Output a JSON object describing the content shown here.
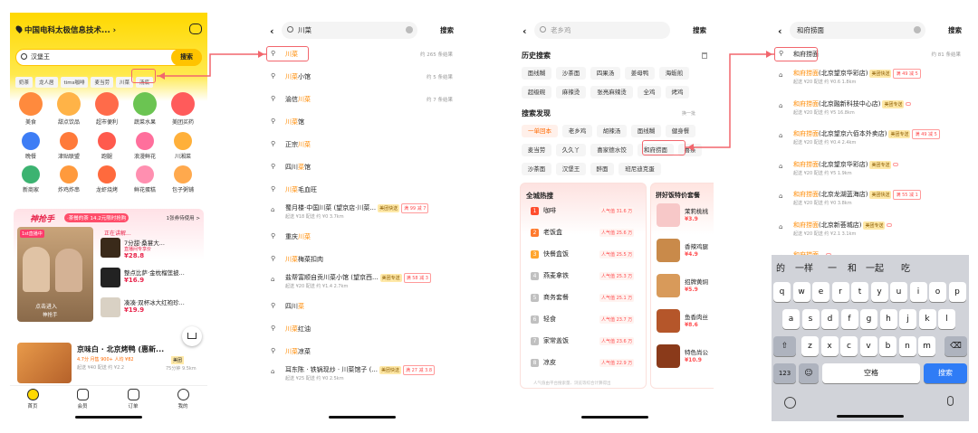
{
  "p1": {
    "location": "中国电科太极信息技术...",
    "search_value": "汉堡王",
    "search_btn": "搜索",
    "hot_tags": [
      "奶茶",
      "龙人居",
      "tims咖啡",
      "麦当劳",
      "川菜",
      "汤底"
    ],
    "categories": [
      {
        "label": "美食",
        "color": "#ff8a3d"
      },
      {
        "label": "甜点饮品",
        "color": "#ffb347"
      },
      {
        "label": "超市便利",
        "color": "#ff6b4a"
      },
      {
        "label": "蔬菜水果",
        "color": "#6bc452"
      },
      {
        "label": "美团买药",
        "color": "#ff5b5b"
      },
      {
        "label": "晚餐",
        "color": "#3d7df5"
      },
      {
        "label": "津贴联盟",
        "color": "#ff7a3a"
      },
      {
        "label": "跑腿",
        "color": "#ff5a4d"
      },
      {
        "label": "浪漫鲜花",
        "color": "#ff6f9c"
      },
      {
        "label": "川湘菜",
        "color": "#ffb03a"
      },
      {
        "label": "新商家",
        "color": "#3cb371"
      },
      {
        "label": "炸鸡炸串",
        "color": "#ff9a3d"
      },
      {
        "label": "龙虾烧烤",
        "color": "#ff6a3d"
      },
      {
        "label": "鲜花蛋糕",
        "color": "#ff8fb0"
      },
      {
        "label": "包子粥铺",
        "color": "#ffa94d"
      }
    ],
    "grab_title": "神抢手",
    "grab_tag": "·茶餐的茶 14.2元限时抢购",
    "grab_more": "1张券待使用 >",
    "live": "正在讲解...",
    "live_items": [
      {
        "name": "7分甜·桑葚大...",
        "tag": "直播间专享价",
        "price": "¥28.8"
      },
      {
        "name": "整点比萨·金枕榴莲披...",
        "tag": "",
        "price": "¥16.9"
      },
      {
        "name": "凑凑·双杯冰大红袍珍...",
        "tag": "",
        "price": "¥19.9"
      }
    ],
    "live_label": "1st直播中",
    "live_btn": "神抢手",
    "live_sub": "点击进入",
    "shop_name": "京味白 · 北京烤鸭 (惠新...",
    "shop_meta": "4.7分  月售 900+  人均 ¥82",
    "shop_sub": "起送 ¥40  配送 约 ¥2.2",
    "shop_badge": "美团",
    "shop_dist": "75分钟 9.5km",
    "tabs": [
      "首页",
      "会员",
      "订单",
      "我的"
    ]
  },
  "p2": {
    "query": "川菜",
    "search_btn": "搜索",
    "suggestions": [
      {
        "pre": "",
        "hl": "川菜",
        "post": "",
        "count": "约 265 条结果"
      },
      {
        "pre": "",
        "hl": "川菜",
        "post": "小馆",
        "count": "约 5 条结果"
      },
      {
        "pre": "渝信",
        "hl": "川菜",
        "post": "",
        "count": "约 7 条结果"
      },
      {
        "pre": "",
        "hl": "川菜",
        "post": "馆",
        "count": ""
      },
      {
        "pre": "正宗",
        "hl": "川菜",
        "post": "",
        "count": ""
      },
      {
        "pre": "四川",
        "hl": "菜",
        "post": "馆",
        "count": ""
      },
      {
        "pre": "",
        "hl": "川菜",
        "post": "毛血旺",
        "count": ""
      }
    ],
    "shop1": {
      "name": "蜀月楼·中国川菜 (望京店·川菜...",
      "sub": "起送 ¥18  配送 约 ¥0  3.7km",
      "b1": "美团快送",
      "b2": "满 99 减 7"
    },
    "more": [
      {
        "pre": "重庆",
        "hl": "川菜",
        "post": ""
      },
      {
        "pre": "",
        "hl": "川菜",
        "post": "梅菜扣肉"
      }
    ],
    "shop2": {
      "name": "盐帮富顺自贡川菜小馆 (望京西...",
      "sub": "起送 ¥20  配送 约 ¥1.4  2.7km",
      "b1": "美团专送",
      "b2": "满 58 减 3"
    },
    "more2": [
      {
        "pre": "四川",
        "hl": "菜",
        "post": ""
      },
      {
        "pre": "",
        "hl": "川菜",
        "post": "红油"
      },
      {
        "pre": "",
        "hl": "川菜",
        "post": "凉菜"
      }
    ],
    "shop3": {
      "name": "耳东陈 · 铁锅现炒 · 川菜馆子 (...",
      "sub": "起送 ¥25  配送 约 ¥0  2.5km",
      "b1": "美团快送",
      "b2": "满 27 减 3.8"
    }
  },
  "p3": {
    "placeholder": "老乡鸡",
    "search_btn": "搜索",
    "history_title": "历史搜索",
    "history": [
      "面线糊",
      "沙茶面",
      "四果汤",
      "姜母鸭",
      "海蛎煎",
      "超级碗",
      "麻辣烫",
      "张亮麻辣烫",
      "全鸡",
      "烤鸡"
    ],
    "discover_title": "搜索发现",
    "discover_more": "换一批",
    "discover": [
      "一单回本",
      "老乡鸡",
      "胡辣汤",
      "面线糊",
      "健身餐",
      "麦当劳",
      "久久丫",
      "喜家德水饺",
      "和府捞面",
      "喜茶",
      "沙茶面",
      "汉堡王",
      "醉面",
      "班尼迪克蛋"
    ],
    "hot_title": "全城热搜",
    "hot": [
      {
        "n": "1",
        "name": "咖啡",
        "heat": "人气值 31.6 万"
      },
      {
        "n": "2",
        "name": "老饭盒",
        "heat": "人气值 25.6 万"
      },
      {
        "n": "3",
        "name": "快餐盒饭",
        "heat": "人气值 25.5 万"
      },
      {
        "n": "4",
        "name": "燕麦拿铁",
        "heat": "人气值 25.3 万"
      },
      {
        "n": "5",
        "name": "商务套餐",
        "heat": "人气值 25.1 万"
      },
      {
        "n": "6",
        "name": "轻食",
        "heat": "人气值 23.7 万"
      },
      {
        "n": "7",
        "name": "家常盖饭",
        "heat": "人气值 23.6 万"
      },
      {
        "n": "8",
        "name": "凉皮",
        "heat": "人气值 22.9 万"
      }
    ],
    "hot_foot": "人气值由平台搜索量、浏览等综合计算得出",
    "deal_title": "拼好饭特价套餐",
    "deals": [
      {
        "name": "茉莉桃桃",
        "price": "¥3.9"
      },
      {
        "name": "香辣鸡腿",
        "price": "¥4.9"
      },
      {
        "name": "招牌黄焖",
        "price": "¥5.9"
      },
      {
        "name": "鱼香肉丝",
        "price": "¥8.6"
      },
      {
        "name": "特色尚公",
        "price": "¥10.9"
      }
    ]
  },
  "p4": {
    "query": "和府捞面",
    "search_btn": "搜索",
    "top": {
      "hl": "和府捞面",
      "count": "约 81 条结果"
    },
    "shops": [
      {
        "name": "(北京望京华彩店)",
        "sub": "起送 ¥20  配送 约 ¥0.6  1.8km",
        "b1": "美团快送",
        "b2": "满 49 减 5"
      },
      {
        "name": "(北京融新科技中心店)",
        "sub": "起送 ¥20  配送 约 ¥5  16.8km",
        "b1": "美团专送",
        "b2": ""
      },
      {
        "name": "(北京望京六佰本外卖店)",
        "sub": "起送 ¥20  配送 约 ¥0.4  2.4km",
        "b1": "美团专送",
        "b2": "满 49 减 5"
      },
      {
        "name": "(北京望京华彩店)",
        "sub": "起送 ¥20  配送 约 ¥5  1.9km",
        "b1": "美团专送",
        "b2": ""
      },
      {
        "name": "(北京龙湖蓝海店)",
        "sub": "起送 ¥20  配送 约 ¥0  3.8km",
        "b1": "美团快送",
        "b2": "满 55 减 1"
      },
      {
        "name": "(北京新荟城店)",
        "sub": "起送 ¥20  配送 约 ¥2.1  3.1km",
        "b1": "美团专送",
        "b2": ""
      },
      {
        "name": "",
        "sub": "起送 ¥20  配送 约 ¥7.8  4.1km",
        "b1": "",
        "b2": ""
      }
    ],
    "candidates": [
      "的",
      "一样",
      "一",
      "和",
      "一起",
      "吃"
    ],
    "row1": [
      "q",
      "w",
      "e",
      "r",
      "t",
      "y",
      "u",
      "i",
      "o",
      "p"
    ],
    "row2": [
      "a",
      "s",
      "d",
      "f",
      "g",
      "h",
      "j",
      "k",
      "l"
    ],
    "row3": [
      "z",
      "x",
      "c",
      "v",
      "b",
      "n",
      "m"
    ],
    "num_key": "123",
    "space": "空格",
    "search_key": "搜索"
  }
}
